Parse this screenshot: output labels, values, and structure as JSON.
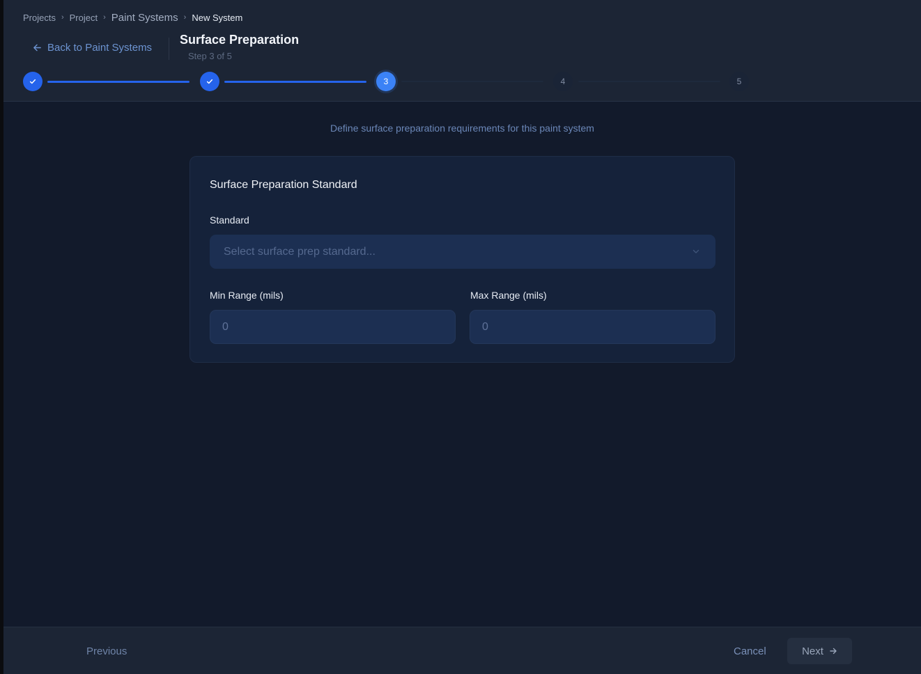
{
  "breadcrumb": [
    "Projects",
    "Project",
    "Paint Systems",
    "New System"
  ],
  "header": {
    "back_label": "Back to Paint Systems",
    "title": "Surface Preparation",
    "step_caption": "Step 3 of 5"
  },
  "stepper": {
    "steps": [
      {
        "label": "1",
        "state": "done"
      },
      {
        "label": "2",
        "state": "done"
      },
      {
        "label": "3",
        "state": "active"
      },
      {
        "label": "4",
        "state": "todo"
      },
      {
        "label": "5",
        "state": "todo"
      }
    ]
  },
  "main": {
    "intro": "Define surface preparation requirements for this paint system",
    "card": {
      "title": "Surface Preparation Standard",
      "standard_label": "Standard",
      "standard_placeholder": "Select surface prep standard...",
      "min_label": "Min Range (mils)",
      "min_value": "0",
      "max_label": "Max Range (mils)",
      "max_value": "0"
    }
  },
  "footer": {
    "previous_label": "Previous",
    "cancel_label": "Cancel",
    "next_label": "Next"
  },
  "colors": {
    "accent": "#2563eb",
    "active_step": "#3b82f6",
    "background": "#121a2b",
    "header": "#1c2535",
    "card": "#15223a",
    "field": "#1c2f52"
  },
  "icons": {
    "back": "arrow-left-icon",
    "check": "check-icon",
    "dropdown": "chevron-down-icon",
    "next": "arrow-right-icon"
  }
}
